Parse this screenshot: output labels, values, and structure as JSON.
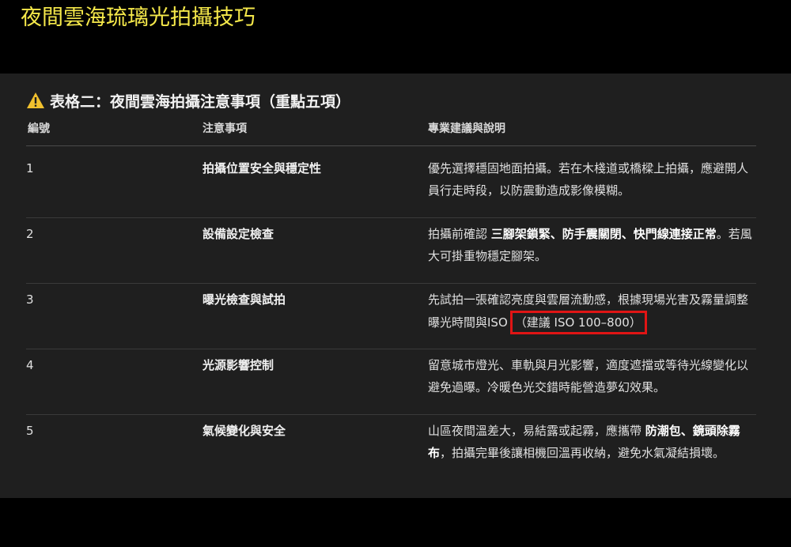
{
  "page": {
    "title": "夜間雲海琉璃光拍攝技巧"
  },
  "table": {
    "heading": "表格二：夜間雲海拍攝注意事項（重點五項）",
    "warning_icon": "warning-triangle-icon",
    "columns": [
      "編號",
      "注意事項",
      "專業建議與說明"
    ],
    "rows": [
      {
        "number": "1",
        "title": "拍攝位置安全與穩定性",
        "desc": [
          "優先選擇穩固地面拍攝。若在木棧道或橋樑上拍攝，應避開人員行走時段，以防震動造成影像模糊。"
        ]
      },
      {
        "number": "2",
        "title": "設備設定檢查",
        "desc_parts": {
          "lead": "拍攝前確認 ",
          "bold": "三腳架鎖緊、防手震關閉、快門線連接正常",
          "tail": "。若風大可掛重物穩定腳架。"
        }
      },
      {
        "number": "3",
        "title": "曝光檢查與試拍",
        "desc_parts": {
          "lead": "先試拍一張確認亮度與雲層流動感，根據現場光害及霧量調整曝光時間與ISO",
          "boxed": "（建議 ISO 100–800）"
        }
      },
      {
        "number": "4",
        "title": "光源影響控制",
        "desc": [
          "留意城市燈光、車軌與月光影響，適度遮擋或等待光線變化以避免過曝。冷暖色光交錯時能營造夢幻效果。"
        ]
      },
      {
        "number": "5",
        "title": "氣候變化與安全",
        "desc_parts": {
          "lead": "山區夜間溫差大，易結露或起霧，應攜帶 ",
          "bold": "防潮包、鏡頭除霧布",
          "tail": "，拍攝完畢後讓相機回溫再收納，避免水氣凝結損壞。"
        }
      }
    ]
  },
  "colors": {
    "title": "#f5e84a",
    "panel": "#1f1f1f",
    "highlight_box": "#e01515",
    "warning": "#f2c12e"
  }
}
